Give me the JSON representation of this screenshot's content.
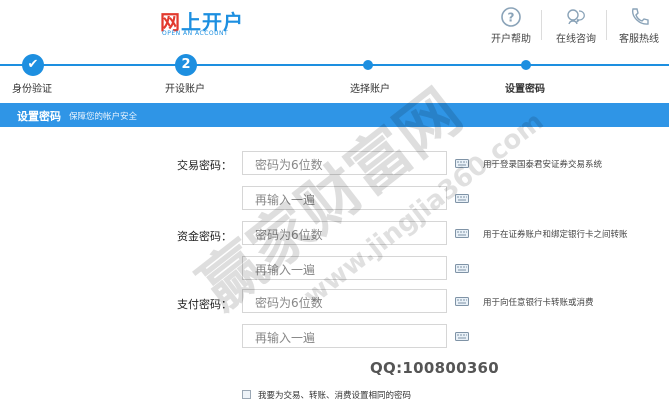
{
  "header": {
    "logo_text_accent": "网",
    "logo_text_main": "上开户",
    "logo_sub": "OPEN AN ACCOUNT",
    "links": [
      {
        "label": "开户帮助",
        "icon": "question-icon"
      },
      {
        "label": "在线咨询",
        "icon": "chat-icon"
      },
      {
        "label": "客服热线",
        "icon": "phone-icon"
      }
    ]
  },
  "progress": {
    "steps": [
      {
        "label": "身份验证",
        "state": "done",
        "marker": "✔"
      },
      {
        "label": "开设账户",
        "state": "numbered",
        "marker": "2"
      },
      {
        "label": "选择账户",
        "state": "pending"
      },
      {
        "label": "设置密码",
        "state": "current"
      }
    ]
  },
  "section": {
    "title": "设置密码",
    "subtitle": "保障您的帐户安全"
  },
  "form": {
    "groups": [
      {
        "label": "交易密码：",
        "placeholder": "密码为6位数",
        "confirm_placeholder": "再输入一遍",
        "hint": "用于登录国泰君安证券交易系统"
      },
      {
        "label": "资金密码：",
        "placeholder": "密码为6位数",
        "confirm_placeholder": "再输入一遍",
        "hint": "用于在证券账户和绑定银行卡之间转账"
      },
      {
        "label": "支付密码：",
        "placeholder": "密码为6位数",
        "confirm_placeholder": "再输入一遍",
        "hint": "用于向任意银行卡转账或消费"
      }
    ],
    "agree_text": "我要为交易、转账、消费设置相同的密码"
  },
  "watermark": {
    "qq": "QQ:100800360",
    "brand": "赢家财富网",
    "url": "www.jingjia360.com"
  },
  "colors": {
    "accent": "#1d8fe0",
    "bar": "#2f95e6",
    "logo_red": "#e23a2e"
  }
}
